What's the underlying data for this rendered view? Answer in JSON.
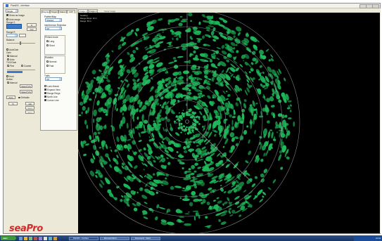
{
  "window": {
    "title": "Plan600 - Interface"
  },
  "left_panel": {
    "mode_select": "Single",
    "show_as_image": "Show as Image",
    "auto_range": "Auto range",
    "range_label": "Range S",
    "zoom_in": "In",
    "zoom_out": "Out",
    "range_r_label": "Range R",
    "balance_label": "Balance",
    "autogain": "AutoGain",
    "gain_label": "Gain",
    "gain_manual": "Manual",
    "gain_auto": "Auto",
    "tvg_label": "TVG/Gain",
    "tvg_fine": "Fine",
    "tvg_coarse": "Coarse",
    "hold": "Hold",
    "button_label": "Button",
    "button_manual": "Manual",
    "apply_btn1": "Save/TVG",
    "apply_btn2": "Save/TVG",
    "auto_btn": "Auto",
    "defaults_btn": "Defaults",
    "small_btn1": "Tx",
    "small_btn2": "Adj",
    "small_btn3": "Start",
    "small_btn4": "Stop"
  },
  "mid_panel": {
    "tabs": [
      "Display",
      "Target",
      "Status",
      "O/P"
    ],
    "palette_label": "Palette/Map",
    "palette_value": "Shaded",
    "resolution_label": "Interference Rejection",
    "resolution_value": "Off",
    "persist_label": "Persist mode",
    "persist_long": "Long",
    "persist_short": "Short",
    "rotation_label": "Rotation",
    "rotation_normal": "Normal",
    "rotation_fast": "Fast",
    "trails_label": "Trails",
    "trails_value": "Off",
    "lock_ahead": "Lock Ahead",
    "expand_view": "Expand View",
    "range_rings": "Range Rings",
    "north_line": "North Line",
    "cursor_line": "Cursor Line"
  },
  "radar": {
    "tabs": [
      "Image 1",
      "Image 2"
    ],
    "info_lines": [
      "Heading",
      "Range Rings: 10 m",
      "Range: 50 m"
    ],
    "header_small": "Sonar Image",
    "screen_bg": "#000000",
    "echo_color": "#1fb85a",
    "ring_color": "#9aa49c"
  },
  "logo": {
    "part1": "sea",
    "part2": "Pro"
  },
  "taskbar": {
    "start": "start",
    "items": [
      "Plan600 - Interface",
      "Microsoft Word",
      "Document1 - Word"
    ],
    "clock": "10:42"
  }
}
